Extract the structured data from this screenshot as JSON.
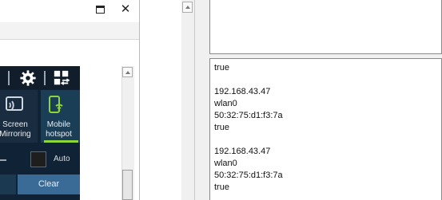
{
  "window": {
    "maximize_icon": "maximize-icon",
    "close_glyph": "✕"
  },
  "quick_panel": {
    "icons": [
      "gear-icon",
      "grid-icon"
    ],
    "tiles": [
      {
        "label_line1": "Screen",
        "label_line2": "Mirroring",
        "icon": "cast-icon"
      },
      {
        "label_line1": "Mobile",
        "label_line2": "hotspot",
        "icon": "hotspot-icon",
        "active": true
      }
    ],
    "auto_label": "Auto",
    "clear_label": "Clear",
    "colors": {
      "background": "#0f2236",
      "active_underline": "#8ed53a",
      "clear_button": "#3a6a96"
    }
  },
  "log": {
    "lines": [
      "true",
      "",
      "192.168.43.47",
      "wlan0",
      "50:32:75:d1:f3:7a",
      "true",
      "",
      "192.168.43.47",
      "wlan0",
      "50:32:75:d1:f3:7a",
      "true"
    ]
  }
}
